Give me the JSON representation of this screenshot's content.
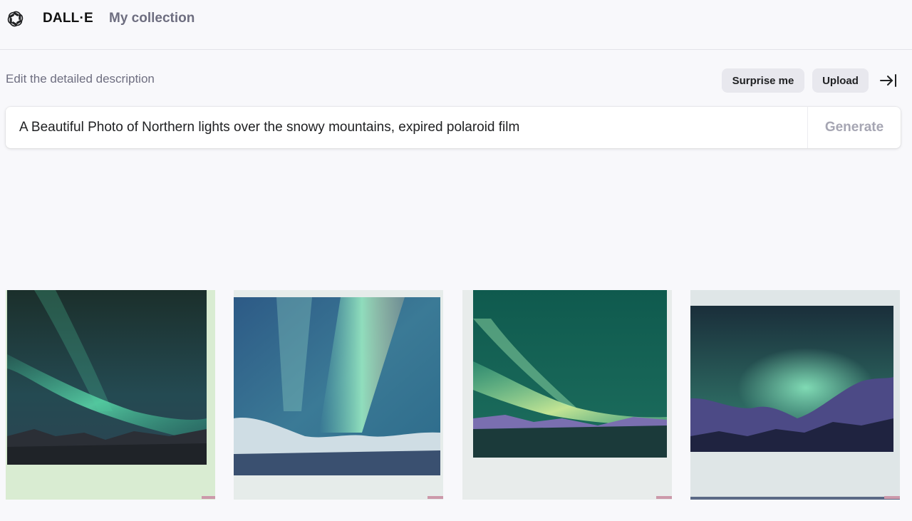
{
  "header": {
    "brand": "DALL·E",
    "nav_collection": "My collection",
    "logo_icon": "openai-logo-icon"
  },
  "editor": {
    "hint": "Edit the detailed description",
    "surprise_label": "Surprise me",
    "upload_label": "Upload",
    "collapse_icon": "arrow-right-to-bar-icon",
    "prompt_value": "A Beautiful Photo of Northern lights over the snowy mountains, expired polaroid film",
    "generate_label": "Generate"
  },
  "results": {
    "images": [
      {
        "subject": "aurora-polaroid-1"
      },
      {
        "subject": "aurora-polaroid-2"
      },
      {
        "subject": "aurora-polaroid-3"
      },
      {
        "subject": "aurora-polaroid-4"
      }
    ]
  },
  "colors": {
    "background": "#f8f8fb",
    "pill": "#e8e8ee",
    "muted_text": "#6e6e80",
    "generate_disabled": "#a6a6b3"
  }
}
